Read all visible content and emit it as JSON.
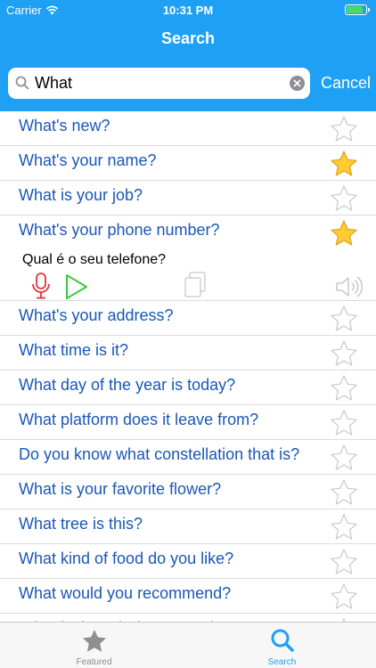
{
  "status_bar": {
    "carrier": "Carrier",
    "time": "10:31 PM",
    "battery_level": 0.9
  },
  "nav": {
    "title": "Search"
  },
  "search": {
    "value": "What",
    "cancel_label": "Cancel"
  },
  "results": [
    {
      "text": "What's new?",
      "starred": false
    },
    {
      "text": "What's your name?",
      "starred": true
    },
    {
      "text": "What is your job?",
      "starred": false
    },
    {
      "text": "What's your phone number?",
      "starred": true
    },
    {
      "text": "What's your address?",
      "starred": false
    },
    {
      "text": "What time is it?",
      "starred": false
    },
    {
      "text": "What day of the year is today?",
      "starred": false
    },
    {
      "text": "What platform does it leave from?",
      "starred": false
    },
    {
      "text": "Do you know what constellation that is?",
      "starred": false
    },
    {
      "text": "What is your favorite flower?",
      "starred": false
    },
    {
      "text": "What tree is this?",
      "starred": false
    },
    {
      "text": "What kind of food do you like?",
      "starred": false
    },
    {
      "text": "What would you recommend?",
      "starred": false
    },
    {
      "text": "What is the Wi-Fi password?",
      "starred": false
    }
  ],
  "expanded": {
    "row_index": 3,
    "translation": "Qual é o seu telefone?"
  },
  "tabs": [
    {
      "label": "Featured",
      "icon": "star-icon",
      "active": false
    },
    {
      "label": "Search",
      "icon": "search-icon",
      "active": true
    }
  ],
  "colors": {
    "accent": "#1ea0f4",
    "link_text": "#1a57b8",
    "star_fill": "#ffcc33",
    "mic": "#e8323c",
    "play": "#3ec83e",
    "inactive": "#8e8e93"
  }
}
